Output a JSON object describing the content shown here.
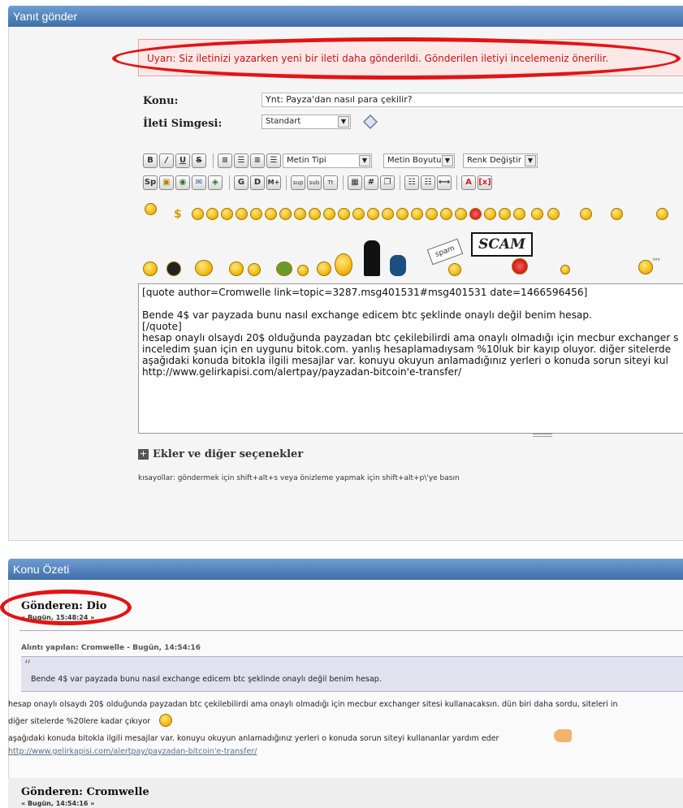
{
  "reply": {
    "header": "Yanıt gönder",
    "warning": "Uyarı: Siz iletinizi yazarken yeni bir ileti daha gönderildi. Gönderilen iletiyi incelemeniz önerilir.",
    "subject_label": "Konu:",
    "subject_value": "Ynt: Payza'dan nasıl para çekilir?",
    "icon_label": "İleti Simgesi:",
    "icon_value": "Standart",
    "toolbar": {
      "bold": "B",
      "italic": "/",
      "underline": "U",
      "strike": "S",
      "font_face": "Metin Tipi",
      "font_size": "Metin Boyutu",
      "color": "Renk Değiştir",
      "sp": "Sp",
      "glow": "G",
      "shadow": "D",
      "marquee": "M+",
      "sup": "sup",
      "sub": "sub",
      "tt": "Tt"
    },
    "stickers": {
      "scam": "SCAM",
      "spam": "spam"
    },
    "message_lines": [
      "[quote author=Cromwelle link=topic=3287.msg401531#msg401531 date=1466596456]",
      "",
      "Bende 4$ var payzada bunu nasıl exchange edicem btc şeklinde onaylı değil benim hesap.",
      "[/quote]",
      "hesap onaylı olsaydı 20$ olduğunda payzadan btc çekilebilirdi ama onaylı olmadığı için mecbur exchanger s",
      "inceledim şuan için en uygunu bitok.com. yanlış hesaplamadıysam %10luk bir kayıp oluyor. diğer sitelerde",
      "aşağıdaki konuda bitokla ilgili mesajlar var. konuyu okuyun anlamadığınız yerleri o konuda sorun siteyi kul",
      "http://www.gelirkapisi.com/alertpay/payzadan-bitcoin'e-transfer/"
    ],
    "attachments_label": "Ekler ve diğer seçenekler",
    "shortcuts": "kısayollar: göndermek için shift+alt+s veya önizleme yapmak için shift+alt+p\\'ye basın"
  },
  "summary": {
    "header": "Konu Özeti",
    "post1": {
      "author": "Gönderen: Dio",
      "date": "« Bugün, 15:48:24 »",
      "quote_header": "Alıntı yapılan: Cromwelle - Bugün, 14:54:16",
      "quote_text": "Bende 4$ var payzada bunu nasıl exchange edicem btc şeklinde onaylı değil benim hesap.",
      "line1": "hesap onaylı olsaydı 20$ olduğunda payzadan btc çekilebilirdi ama onaylı olmadığı için mecbur exchanger sitesi kullanacaksın. dün biri daha sordu, siteleri in",
      "line2": "diğer sitelerde %20lere kadar çıkıyor",
      "line3": "aşağıdaki konuda bitokla ilgili mesajlar var. konuyu okuyun anlamadığınız yerleri o konuda sorun siteyi kullananlar yardım eder",
      "link": "http://www.gelirkapisi.com/alertpay/payzadan-bitcoin'e-transfer/"
    },
    "post2": {
      "author": "Gönderen: Cromwelle",
      "date": "« Bugün, 14:54:16 »"
    }
  },
  "colors": {
    "header_blue": "#4a7bb7",
    "warning_red": "#cc1111",
    "annotation_red": "#e21414"
  }
}
